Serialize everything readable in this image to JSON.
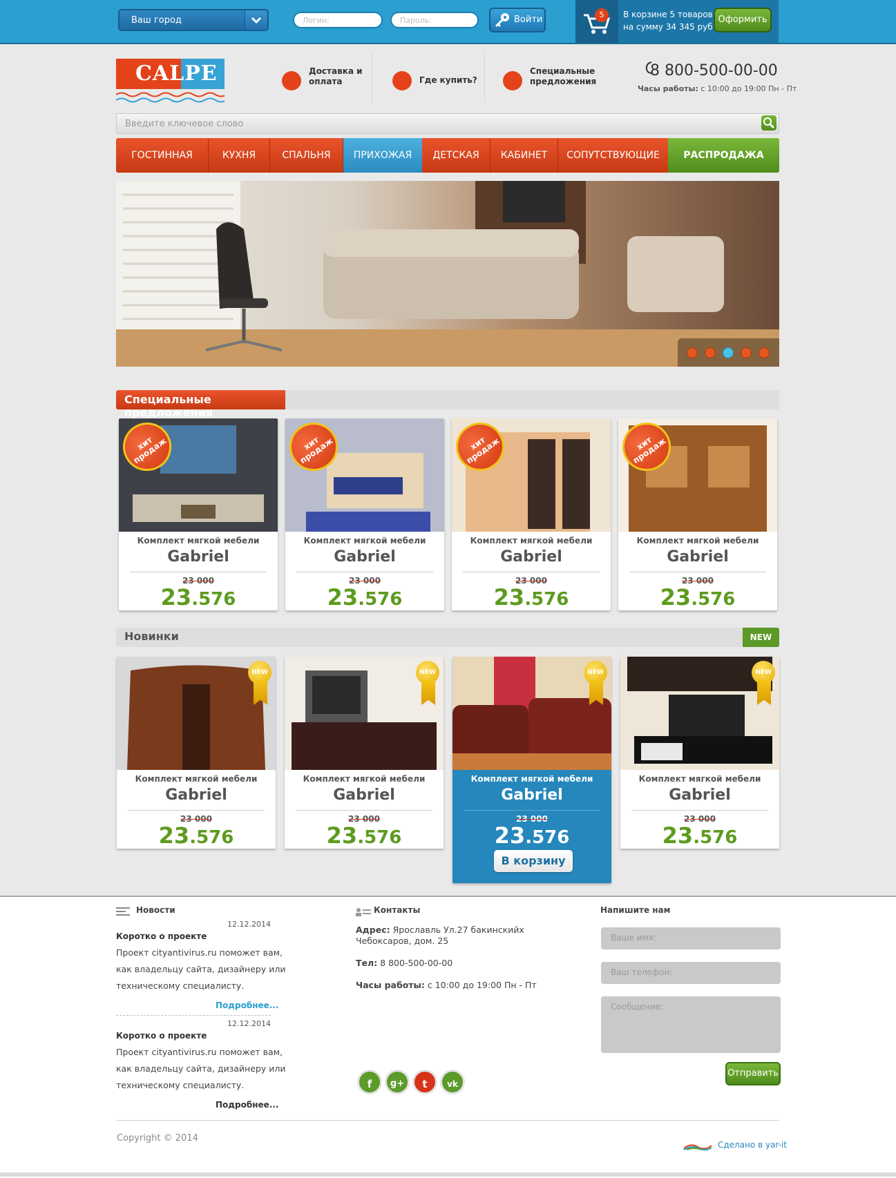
{
  "topbar": {
    "city_label": "Ваш город",
    "login_placeholder": "Логин:",
    "password_placeholder": "Пароль:",
    "login_button": "Войти",
    "cart_count": "5",
    "cart_line1": "В корзине  5 товаров",
    "cart_line2": "на сумму 34 345 руб",
    "checkout_button": "Оформить"
  },
  "header": {
    "logo_text": "CALPE",
    "delivery_label": "Доставка и оплата",
    "where_label": "Где купить?",
    "special_label": "Специальные предложения",
    "phone": "8 800-500-00-00",
    "hours_label": "Часы работы:",
    "hours_value": "с 10:00 до 19:00 Пн - Пт"
  },
  "search": {
    "placeholder": "Введите ключевое слово"
  },
  "nav": {
    "items": [
      "ГОСТИННАЯ",
      "КУХНЯ",
      "СПАЛЬНЯ",
      "ПРИХОЖАЯ",
      "ДЕТСКАЯ",
      "КАБИНЕТ",
      "СОПУТСТВУЮЩИЕ",
      "РАСПРОДАЖА"
    ]
  },
  "special": {
    "title": "Специальные предложения",
    "badge": "хит продаж",
    "products": [
      {
        "desc": "Комплект мягкой мебели",
        "name": "Gabriel",
        "old_price": "23 000",
        "price_big": "23",
        "price_small": ".576"
      },
      {
        "desc": "Комплект мягкой мебели",
        "name": "Gabriel",
        "old_price": "23 000",
        "price_big": "23",
        "price_small": ".576"
      },
      {
        "desc": "Комплект мягкой мебели",
        "name": "Gabriel",
        "old_price": "23 000",
        "price_big": "23",
        "price_small": ".576"
      },
      {
        "desc": "Комплект мягкой мебели",
        "name": "Gabriel",
        "old_price": "23 000",
        "price_big": "23",
        "price_small": ".576"
      }
    ]
  },
  "new": {
    "title": "Новинки",
    "tab": "NEW",
    "badge": "NEW",
    "to_cart": "В корзину",
    "products": [
      {
        "desc": "Комплект мягкой мебели",
        "name": "Gabriel",
        "old_price": "23 000",
        "price_big": "23",
        "price_small": ".576"
      },
      {
        "desc": "Комплект мягкой мебели",
        "name": "Gabriel",
        "old_price": "23 000",
        "price_big": "23",
        "price_small": ".576"
      },
      {
        "desc": "Комплект мягкой мебели",
        "name": "Gabriel",
        "old_price": "23 000",
        "price_big": "23",
        "price_small": ".576"
      },
      {
        "desc": "Комплект мягкой мебели",
        "name": "Gabriel",
        "old_price": "23 000",
        "price_big": "23",
        "price_small": ".576"
      }
    ]
  },
  "footer": {
    "news_title": "Новости",
    "news": [
      {
        "date": "12.12.2014",
        "title": "Коротко о проекте",
        "text1": "Проект cityantivirus.ru поможет вам,",
        "text2": "как владельцу сайта, дизайнеру или",
        "text3": "техническому специалисту.",
        "more": "Подробнее..."
      },
      {
        "date": "12.12.2014",
        "title": "Коротко о проекте",
        "text1": "Проект cityantivirus.ru поможет вам,",
        "text2": "как владельцу сайта, дизайнеру или",
        "text3": "техническому специалисту.",
        "more": "Подробнее..."
      }
    ],
    "contacts_title": "Контакты",
    "address_label": "Адрес:",
    "address_line1": "Ярославль Ул.27 бакинскийх",
    "address_line2": "Чебоксаров, дом. 25",
    "tel_label": "Тел:",
    "tel_value": "8 800-500-00-00",
    "hours_label": "Часы работы:",
    "hours_value": "с 10:00 до 19:00 Пн - Пт",
    "social": [
      "f",
      "g+",
      "t",
      "vk"
    ],
    "write_title": "Напишите нам",
    "name_placeholder": "Ваше имя:",
    "phone_placeholder": "Ваш телефон:",
    "message_placeholder": "Сообщение:",
    "send_button": "Отправить",
    "copyright": "Copyright © 2014",
    "made_by": "Сделано в yar-it"
  },
  "colors": {
    "topbar": "#2a9fd0",
    "brand_red": "#e4431a",
    "brand_green": "#5d9b1e",
    "active_blue": "#2587bc"
  }
}
